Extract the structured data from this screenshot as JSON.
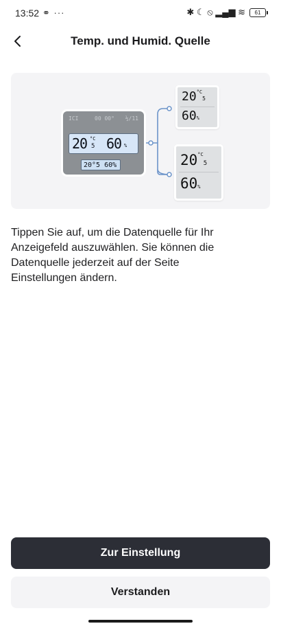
{
  "status_bar": {
    "time": "13:52",
    "left_icons": "⚭ ···",
    "right_icons": "✱ ☾ ⦸ ▂▄▆ ≋",
    "battery": "61"
  },
  "header": {
    "title": "Temp. und Humid. Quelle"
  },
  "illustration": {
    "hub_top_left": "ICI",
    "hub_top_mid": "00 00°",
    "hub_top_right": "½/11",
    "hub_temp": "20",
    "hub_temp_unit": "°C",
    "hub_temp_decimal": "5",
    "hub_humidity": "60",
    "hub_humidity_unit": "%",
    "hub_small": "20°5 60%",
    "sensor_temp": "20",
    "sensor_temp_unit": "°C",
    "sensor_temp_decimal": "5",
    "sensor_humidity": "60",
    "sensor_humidity_unit": "%"
  },
  "description": "Tippen Sie auf, um die Datenquelle für Ihr Anzeigefeld auszuwählen. Sie können die Datenquelle jederzeit auf der Seite Einstellungen ändern.",
  "buttons": {
    "primary": "Zur Einstellung",
    "secondary": "Verstanden"
  },
  "colors": {
    "primary_button": "#2c2e36",
    "secondary_button": "#f4f4f6",
    "connector": "#6b93c9"
  }
}
